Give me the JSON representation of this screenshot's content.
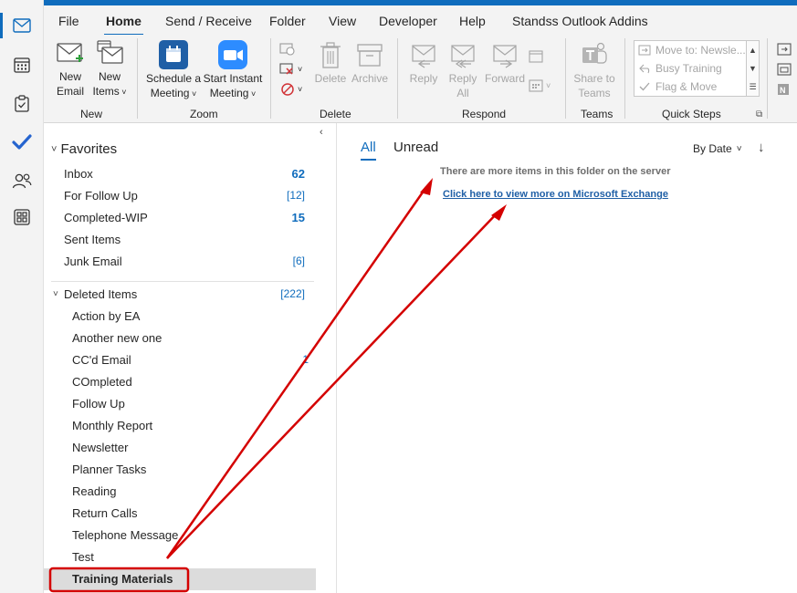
{
  "ribbon": {
    "tabs": [
      "File",
      "Home",
      "Send / Receive",
      "Folder",
      "View",
      "Developer",
      "Help",
      "Standss Outlook Addins"
    ],
    "active_tab": "Home",
    "new": {
      "new_email": [
        "New",
        "Email"
      ],
      "new_items": [
        "New",
        "Items"
      ],
      "label": "New"
    },
    "zoom": {
      "schedule": [
        "Schedule a",
        "Meeting"
      ],
      "instant": [
        "Start Instant",
        "Meeting"
      ],
      "label": "Zoom"
    },
    "delete": {
      "delete": "Delete",
      "archive": "Archive",
      "label": "Delete"
    },
    "respond": {
      "reply": "Reply",
      "reply_all": [
        "Reply",
        "All"
      ],
      "forward": "Forward",
      "label": "Respond"
    },
    "teams": {
      "share": [
        "Share to",
        "Teams"
      ],
      "label": "Teams"
    },
    "quick_steps": {
      "items": [
        "Move to: Newsle...",
        "Busy Training",
        "Flag & Move"
      ],
      "label": "Quick Steps"
    }
  },
  "folders": {
    "favorites_label": "Favorites",
    "favorites": [
      {
        "name": "Inbox",
        "count": "62",
        "bold": true
      },
      {
        "name": "For Follow Up",
        "count": "[12]",
        "bold": false
      },
      {
        "name": "Completed-WIP",
        "count": "15",
        "bold": true
      },
      {
        "name": "Sent Items",
        "count": "",
        "bold": false
      },
      {
        "name": "Junk Email",
        "count": "[6]",
        "bold": false
      }
    ],
    "deleted": {
      "name": "Deleted Items",
      "count": "[222]"
    },
    "subfolders": [
      {
        "name": "Action by EA",
        "count": ""
      },
      {
        "name": "Another new one",
        "count": ""
      },
      {
        "name": "CC'd Email",
        "count": "1"
      },
      {
        "name": "COmpleted",
        "count": ""
      },
      {
        "name": "Follow Up",
        "count": ""
      },
      {
        "name": "Monthly Report",
        "count": ""
      },
      {
        "name": "Newsletter",
        "count": ""
      },
      {
        "name": "Planner Tasks",
        "count": ""
      },
      {
        "name": "Reading",
        "count": ""
      },
      {
        "name": "Return Calls",
        "count": ""
      },
      {
        "name": "Telephone Message",
        "count": ""
      },
      {
        "name": "Test",
        "count": ""
      },
      {
        "name": "Training Materials",
        "count": ""
      }
    ],
    "selected": "Training Materials"
  },
  "messages": {
    "filters": [
      "All",
      "Unread"
    ],
    "active_filter": "All",
    "sort_label": "By Date",
    "server_note": "There are more items in this folder on the server",
    "exchange_link": "Click here to view more on Microsoft Exchange"
  },
  "colors": {
    "accent": "#0f6cbd",
    "annotation": "#d40000"
  }
}
